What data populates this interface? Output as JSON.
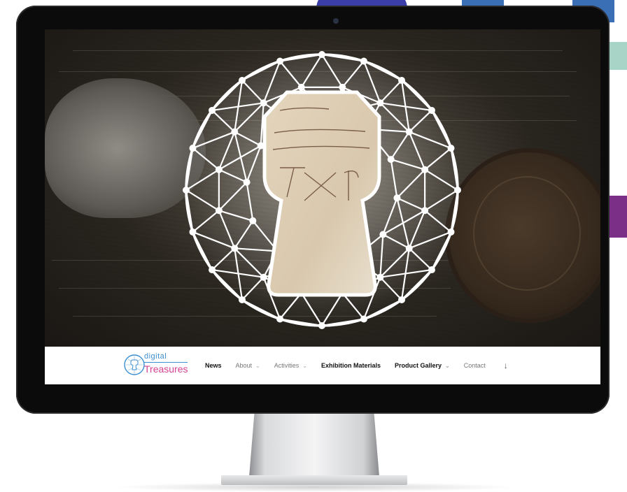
{
  "logo": {
    "line1": "digital",
    "line2": "Treasures",
    "icon": "keyhole-globe-icon",
    "colors": {
      "digital": "#3c8fd1",
      "treasures": "#d64291"
    }
  },
  "nav": {
    "items": [
      {
        "label": "News",
        "bold": true,
        "dropdown": false
      },
      {
        "label": "About",
        "bold": false,
        "dropdown": true
      },
      {
        "label": "Activities",
        "bold": false,
        "dropdown": true
      },
      {
        "label": "Exhibition Materials",
        "bold": true,
        "dropdown": false
      },
      {
        "label": "Product Gallery",
        "bold": true,
        "dropdown": true
      },
      {
        "label": "Contact",
        "bold": false,
        "dropdown": false
      }
    ],
    "scroll_icon": "arrow-down-icon"
  },
  "hero": {
    "emblem_icon": "keyhole-network-emblem"
  }
}
